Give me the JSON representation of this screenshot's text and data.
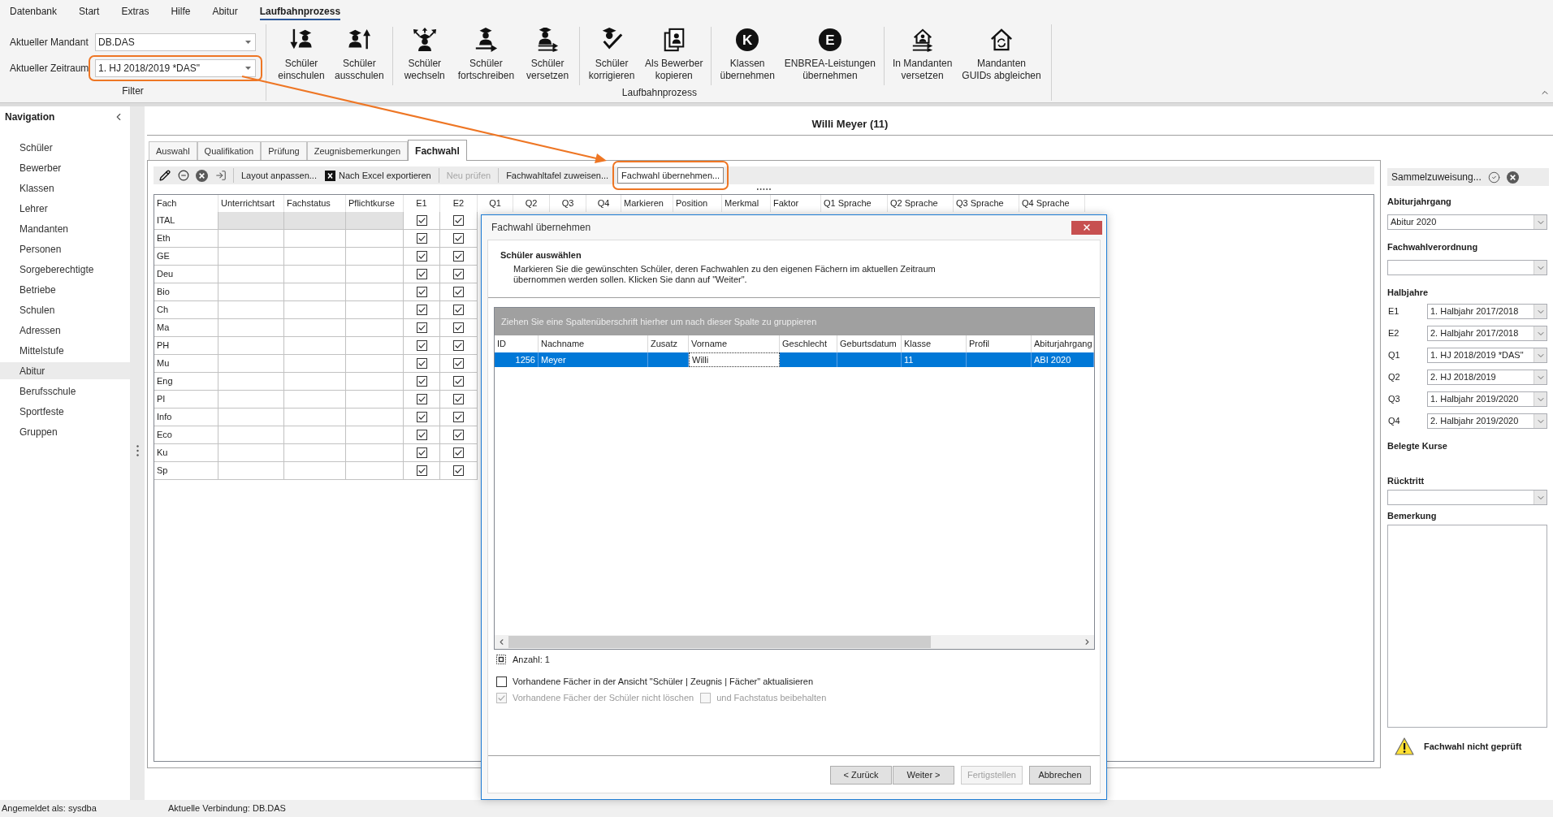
{
  "menu": [
    {
      "label": "Datenbank",
      "selected": false
    },
    {
      "label": "Start",
      "selected": false
    },
    {
      "label": "Extras",
      "selected": false
    },
    {
      "label": "Hilfe",
      "selected": false
    },
    {
      "label": "Abitur",
      "selected": false
    },
    {
      "label": "Laufbahnprozess",
      "selected": true
    }
  ],
  "filter": {
    "label": "Filter",
    "fields": [
      {
        "label": "Aktueller Mandant",
        "value": "DB.DAS",
        "highlighted": false
      },
      {
        "label": "Aktueller Zeitraum",
        "value": "1. HJ 2018/2019 *DAS\"",
        "highlighted": true
      }
    ]
  },
  "ribbon": {
    "label": "Laufbahnprozess",
    "sections": [
      [
        {
          "kind": "enroll",
          "lines": [
            "Schüler",
            "einschulen"
          ]
        },
        {
          "kind": "unenroll",
          "lines": [
            "Schüler",
            "ausschulen"
          ]
        }
      ],
      [
        {
          "kind": "switch",
          "lines": [
            "Schüler",
            "wechseln"
          ]
        },
        {
          "kind": "advance",
          "lines": [
            "Schüler",
            "fortschreiben"
          ]
        },
        {
          "kind": "promote",
          "lines": [
            "Schüler",
            "versetzen"
          ]
        }
      ],
      [
        {
          "kind": "correct",
          "lines": [
            "Schüler",
            "korrigieren"
          ]
        },
        {
          "kind": "copy",
          "lines": [
            "Als Bewerber",
            "kopieren"
          ]
        }
      ],
      [
        {
          "kind": "letter",
          "letter": "K",
          "lines": [
            "Klassen",
            "übernehmen"
          ]
        },
        {
          "kind": "letter",
          "letter": "E",
          "lines": [
            "ENBREA-Leistungen",
            "übernehmen"
          ]
        }
      ],
      [
        {
          "kind": "house-move",
          "lines": [
            "In Mandanten",
            "versetzen"
          ]
        },
        {
          "kind": "house-sync",
          "lines": [
            "Mandanten",
            "GUIDs abgleichen"
          ]
        }
      ]
    ]
  },
  "navigation": {
    "title": "Navigation",
    "items": [
      {
        "label": "Schüler",
        "selected": false
      },
      {
        "label": "Bewerber",
        "selected": false
      },
      {
        "label": "Klassen",
        "selected": false
      },
      {
        "label": "Lehrer",
        "selected": false
      },
      {
        "label": "Mandanten",
        "selected": false
      },
      {
        "label": "Personen",
        "selected": false
      },
      {
        "label": "Sorgeberechtigte",
        "selected": false
      },
      {
        "label": "Betriebe",
        "selected": false
      },
      {
        "label": "Schulen",
        "selected": false
      },
      {
        "label": "Adressen",
        "selected": false
      },
      {
        "label": "Mittelstufe",
        "selected": false
      },
      {
        "label": "Abitur",
        "selected": true
      },
      {
        "label": "Berufsschule",
        "selected": false
      },
      {
        "label": "Sportfeste",
        "selected": false
      },
      {
        "label": "Gruppen",
        "selected": false
      }
    ]
  },
  "title": "Willi Meyer (11)",
  "tabs": [
    {
      "label": "Auswahl",
      "selected": false
    },
    {
      "label": "Qualifikation",
      "selected": false
    },
    {
      "label": "Prüfung",
      "selected": false
    },
    {
      "label": "Zeugnisbemerkungen",
      "selected": false
    },
    {
      "label": "Fachwahl",
      "selected": true
    }
  ],
  "toolbar": {
    "groups": [
      [
        {
          "kind": "text",
          "label": "Layout anpassen...",
          "disabled": false,
          "focused": false,
          "highlighted": false
        },
        {
          "kind": "excel",
          "label": "Nach Excel exportieren",
          "disabled": false,
          "focused": false,
          "highlighted": false
        }
      ],
      [
        {
          "kind": "text",
          "label": "Neu prüfen",
          "disabled": true,
          "focused": false,
          "highlighted": false
        }
      ],
      [
        {
          "kind": "text",
          "label": "Fachwahltafel zuweisen...",
          "disabled": false,
          "focused": false,
          "highlighted": false
        },
        {
          "kind": "text",
          "label": "Fachwahl übernehmen...",
          "disabled": false,
          "focused": true,
          "highlighted": true
        }
      ]
    ]
  },
  "subject_grid": {
    "columns": [
      {
        "label": "Fach",
        "kind": "text"
      },
      {
        "label": "Unterrichtsart",
        "kind": "text"
      },
      {
        "label": "Fachstatus",
        "kind": "text"
      },
      {
        "label": "Pflichtkurse",
        "kind": "text"
      },
      {
        "label": "E1",
        "kind": "check"
      },
      {
        "label": "E2",
        "kind": "check"
      },
      {
        "label": "Q1",
        "kind": "check"
      },
      {
        "label": "Q2",
        "kind": "check"
      },
      {
        "label": "Q3",
        "kind": "check"
      },
      {
        "label": "Q4",
        "kind": "check"
      },
      {
        "label": "Markieren",
        "kind": "text"
      },
      {
        "label": "Position",
        "kind": "text"
      },
      {
        "label": "Merkmal",
        "kind": "text"
      },
      {
        "label": "Faktor",
        "kind": "text"
      },
      {
        "label": "Q1 Sprache",
        "kind": "text"
      },
      {
        "label": "Q2 Sprache",
        "kind": "text"
      },
      {
        "label": "Q3 Sprache",
        "kind": "text"
      },
      {
        "label": "Q4 Sprache",
        "kind": "text"
      }
    ],
    "rows": [
      {
        "fach": "ITAL",
        "e1": true,
        "e2": true,
        "selected": true
      },
      {
        "fach": "Eth",
        "e1": true,
        "e2": true,
        "selected": false
      },
      {
        "fach": "GE",
        "e1": true,
        "e2": true,
        "selected": false
      },
      {
        "fach": "Deu",
        "e1": true,
        "e2": true,
        "selected": false
      },
      {
        "fach": "Bio",
        "e1": true,
        "e2": true,
        "selected": false
      },
      {
        "fach": "Ch",
        "e1": true,
        "e2": true,
        "selected": false
      },
      {
        "fach": "Ma",
        "e1": true,
        "e2": true,
        "selected": false
      },
      {
        "fach": "PH",
        "e1": true,
        "e2": true,
        "selected": false
      },
      {
        "fach": "Mu",
        "e1": true,
        "e2": true,
        "selected": false
      },
      {
        "fach": "Eng",
        "e1": true,
        "e2": true,
        "selected": false
      },
      {
        "fach": "PI",
        "e1": true,
        "e2": true,
        "selected": false
      },
      {
        "fach": "Info",
        "e1": true,
        "e2": true,
        "selected": false
      },
      {
        "fach": "Eco",
        "e1": true,
        "e2": true,
        "selected": false
      },
      {
        "fach": "Ku",
        "e1": true,
        "e2": true,
        "selected": false
      },
      {
        "fach": "Sp",
        "e1": true,
        "e2": true,
        "selected": false
      }
    ]
  },
  "side_panel": {
    "toolbar": {
      "label": "Sammelzuweisung..."
    },
    "abiturjahrgang": {
      "label": "Abiturjahrgang",
      "value": "Abitur 2020"
    },
    "fachwahlverordnung": {
      "label": "Fachwahlverordnung"
    },
    "halbjahre": {
      "label": "Halbjahre",
      "rows": [
        {
          "label": "E1",
          "value": "1. Halbjahr 2017/2018"
        },
        {
          "label": "E2",
          "value": "2. Halbjahr 2017/2018"
        },
        {
          "label": "Q1",
          "value": "1. HJ 2018/2019 *DAS\""
        },
        {
          "label": "Q2",
          "value": "2. HJ 2018/2019"
        },
        {
          "label": "Q3",
          "value": "1. Halbjahr 2019/2020"
        },
        {
          "label": "Q4",
          "value": "2. Halbjahr 2019/2020"
        }
      ]
    },
    "belegte_kurse": {
      "label": "Belegte Kurse"
    },
    "ruecktritt": {
      "label": "Rücktritt"
    },
    "bemerkung": {
      "label": "Bemerkung"
    },
    "warning": "Fachwahl nicht geprüft"
  },
  "dialog": {
    "title": "Fachwahl übernehmen",
    "heading": "Schüler auswählen",
    "description": "Markieren Sie die gewünschten Schüler, deren Fachwahlen zu den eigenen Fächern im aktuellen Zeitraum übernommen werden sollen. Klicken Sie dann auf \"Weiter\".",
    "group_hint": "Ziehen Sie eine Spaltenüberschrift hierher um nach dieser Spalte zu gruppieren",
    "columns": [
      "ID",
      "Nachname",
      "Zusatz",
      "Vorname",
      "Geschlecht",
      "Geburtsdatum",
      "Klasse",
      "Profil",
      "Abiturjahrgang"
    ],
    "rows": [
      {
        "selected": true,
        "cells": [
          {
            "text": "1256",
            "focused": false
          },
          {
            "text": "Meyer",
            "focused": false
          },
          {
            "focused": false
          },
          {
            "text": "Willi",
            "focused": true
          },
          {
            "focused": false
          },
          {
            "focused": false
          },
          {
            "text": "11",
            "focused": false
          },
          {
            "focused": false
          },
          {
            "text": "ABI 2020",
            "focused": false
          }
        ]
      }
    ],
    "count": "Anzahl: 1",
    "option_rows": [
      [
        {
          "label": "Vorhandene Fächer in der Ansicht \"Schüler | Zeugnis | Fächer\" aktualisieren",
          "checked": false,
          "disabled": false
        }
      ],
      [
        {
          "label": "Vorhandene Fächer der Schüler nicht löschen",
          "checked": true,
          "disabled": true
        },
        {
          "label": "und Fachstatus beibehalten",
          "checked": false,
          "disabled": true
        }
      ]
    ],
    "button_groups": [
      [
        {
          "label": "< Zurück",
          "disabled": false
        },
        {
          "label": "Weiter >",
          "disabled": false
        }
      ],
      [
        {
          "label": "Fertigstellen",
          "disabled": true
        }
      ],
      [
        {
          "label": "Abbrechen",
          "disabled": false
        }
      ]
    ]
  },
  "status_bar": {
    "items": [
      "Angemeldet als: sysdba",
      "Aktuelle Verbindung: DB.DAS"
    ]
  }
}
